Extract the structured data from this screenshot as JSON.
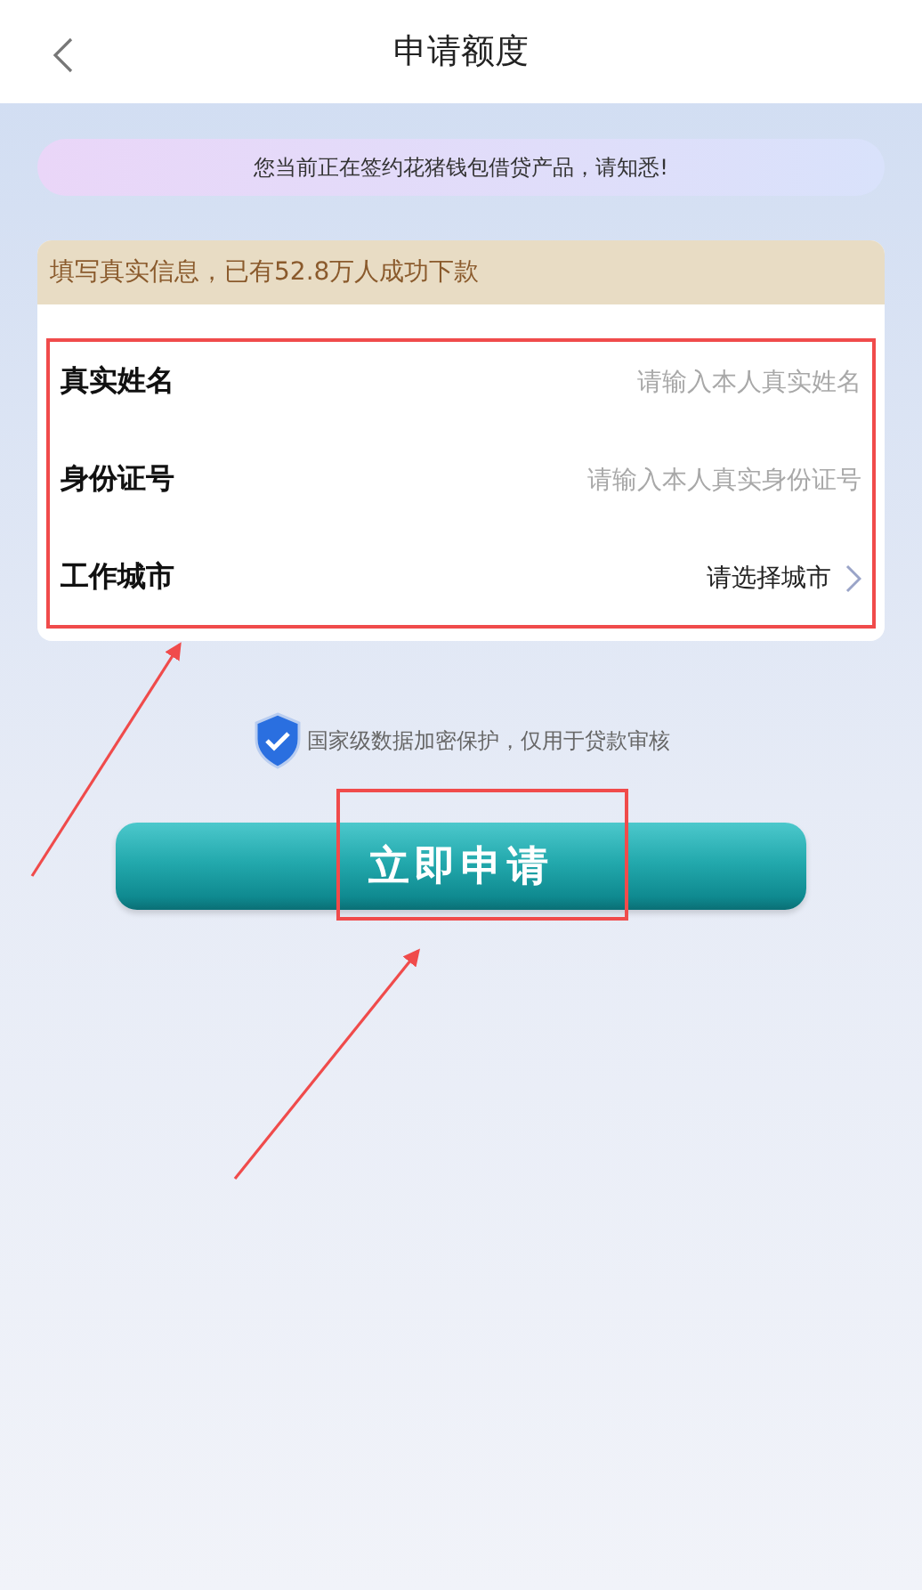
{
  "header": {
    "title": "申请额度"
  },
  "notice": "您当前正在签约花猪钱包借贷产品，请知悉!",
  "form": {
    "banner": "填写真实信息，已有52.8万人成功下款",
    "fields": [
      {
        "kind": "input",
        "label": "真实姓名",
        "placeholder": "请输入本人真实姓名"
      },
      {
        "kind": "input",
        "label": "身份证号",
        "placeholder": "请输入本人真实身份证号"
      },
      {
        "kind": "select",
        "label": "工作城市",
        "value": "请选择城市"
      }
    ]
  },
  "security_note": "国家级数据加密保护，仅用于贷款审核",
  "submit_button": "立即申请"
}
